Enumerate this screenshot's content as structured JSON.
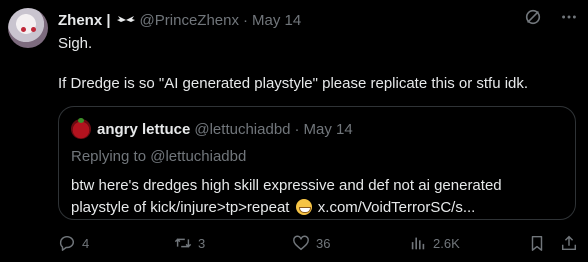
{
  "author": {
    "name": "Zhenx |",
    "handle": "@PrinceZhenx",
    "date": "May 14"
  },
  "post": {
    "line1": "Sigh.",
    "line2": "If Dredge is so \"AI generated playstyle\" please replicate this or stfu idk."
  },
  "quote": {
    "name": "angry lettuce",
    "handle": "@lettuchiadbd",
    "date": "May 14",
    "replying": "Replying to @lettuchiadbd",
    "text_before_emoji": "btw here's dredges high skill expressive and def not ai generated playstyle of kick/injure>tp>repeat",
    "link": "x.com/VoidTerrorSC/s..."
  },
  "actions": {
    "replies": "4",
    "reposts": "3",
    "likes": "36",
    "views": "2.6K"
  },
  "icons": [
    "grok-icon",
    "more-icon",
    "reply-icon",
    "repost-icon",
    "like-icon",
    "views-icon",
    "bookmark-icon",
    "share-icon"
  ],
  "colors": {
    "background": "#000000",
    "text": "#e7e9ea",
    "muted": "#71767b",
    "border": "#2f3336"
  }
}
